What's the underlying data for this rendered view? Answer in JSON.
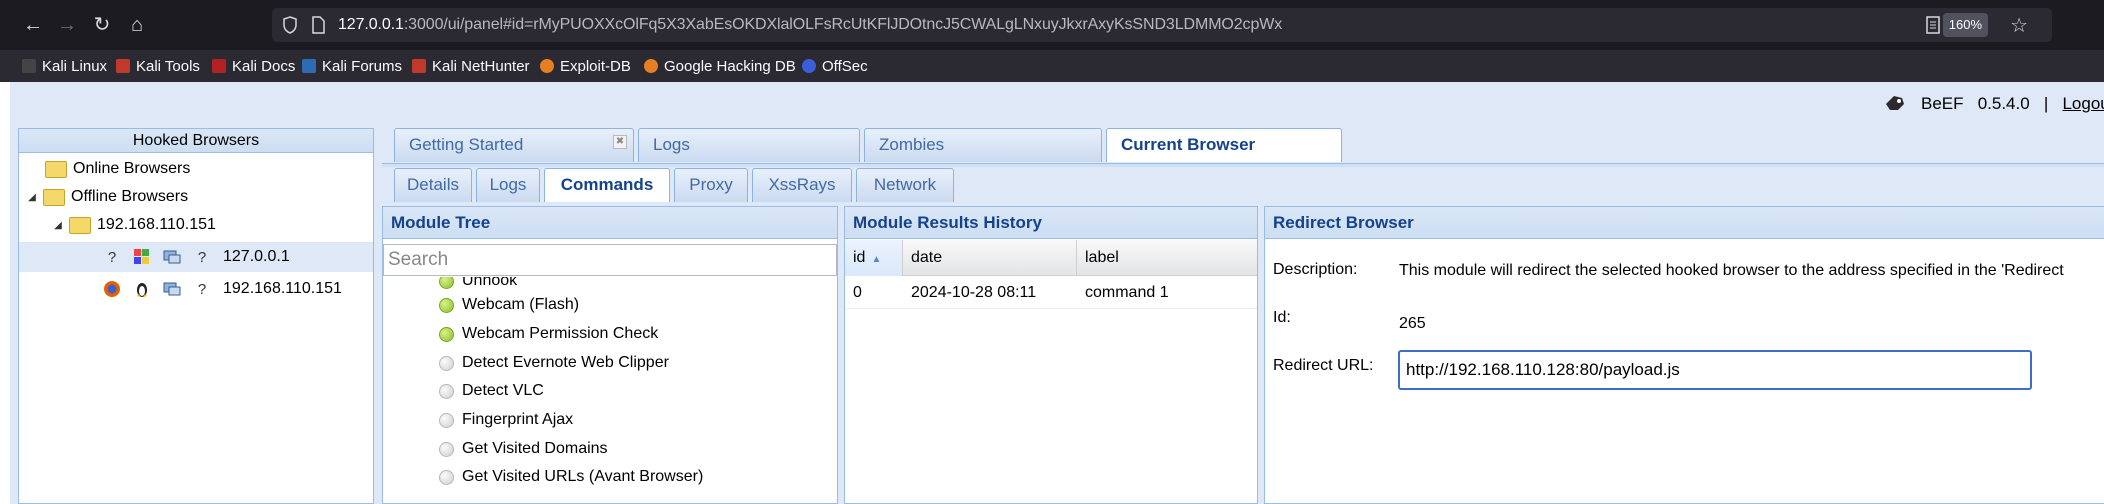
{
  "browser": {
    "url_host": "127.0.0.1",
    "url_rest": ":3000/ui/panel#id=rMyPUOXXcOlFq5X3XabEsOKDXlalOLFsRcUtKFlJDOtncJ5CWALgLNxuyJkxrAxyKsSND3LDMMO2cpWx",
    "zoom": "160%",
    "bookmarks": [
      "Kali Linux",
      "Kali Tools",
      "Kali Docs",
      "Kali Forums",
      "Kali NetHunter",
      "Exploit-DB",
      "Google Hacking DB",
      "OffSec"
    ]
  },
  "beef": {
    "name": "BeEF",
    "version": "0.5.4.0",
    "separator": "|",
    "logout": "Logout"
  },
  "left": {
    "title": "Hooked Browsers",
    "online": "Online Browsers",
    "offline": "Offline Browsers",
    "host": "192.168.110.151",
    "sessions": [
      {
        "ip": "127.0.0.1",
        "os_icon": "windows-icon"
      },
      {
        "ip": "192.168.110.151",
        "os_icon": "linux-icon"
      }
    ],
    "unknown_glyph": "?"
  },
  "tabs_main": [
    "Getting Started",
    "Logs",
    "Zombies",
    "Current Browser"
  ],
  "tabs_sub": [
    "Details",
    "Logs",
    "Commands",
    "Proxy",
    "XssRays",
    "Network"
  ],
  "module_tree": {
    "title": "Module Tree",
    "search_placeholder": "Search",
    "items": [
      {
        "label": "Unhook",
        "status": "green"
      },
      {
        "label": "Webcam (Flash)",
        "status": "green"
      },
      {
        "label": "Webcam Permission Check",
        "status": "green"
      },
      {
        "label": "Detect Evernote Web Clipper",
        "status": "grey"
      },
      {
        "label": "Detect VLC",
        "status": "grey"
      },
      {
        "label": "Fingerprint Ajax",
        "status": "grey"
      },
      {
        "label": "Get Visited Domains",
        "status": "grey"
      },
      {
        "label": "Get Visited URLs (Avant Browser)",
        "status": "grey"
      }
    ]
  },
  "results": {
    "title": "Module Results History",
    "columns": [
      "id",
      "date",
      "label"
    ],
    "rows": [
      {
        "id": "0",
        "date": "2024-10-28 08:11",
        "label": "command 1"
      }
    ]
  },
  "redirect": {
    "title": "Redirect Browser",
    "description_label": "Description:",
    "description": "This module will redirect the selected hooked browser to the address specified in the 'Redirect",
    "id_label": "Id:",
    "id_value": "265",
    "url_label": "Redirect URL:",
    "url_value": "http://192.168.110.128:80/payload.js"
  },
  "colors": {
    "accent": "#15428b",
    "panel_border": "#99bbe8",
    "panel_bg": "#dfe8f6",
    "input_focus": "#3d6ec4"
  }
}
